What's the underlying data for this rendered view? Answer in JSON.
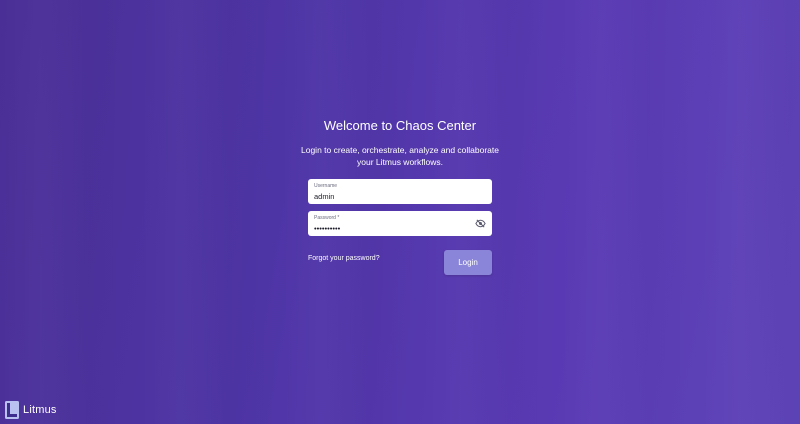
{
  "login": {
    "title": "Welcome to Chaos Center",
    "subtitle_line1": "Login to create, orchestrate, analyze and collaborate",
    "subtitle_line2": "your Litmus workflows.",
    "username": {
      "label": "Username",
      "value": "admin"
    },
    "password": {
      "label": "Password *",
      "value": "••••••••••",
      "toggle_icon": "eye-off-icon"
    },
    "forgot_label": "Forgot your password?",
    "login_label": "Login"
  },
  "brand": {
    "name": "Litmus",
    "logo_icon": "litmus-logo-icon"
  },
  "colors": {
    "background_start": "#4a2f96",
    "background_end": "#5e44b8",
    "login_button": "#8a85d8",
    "field_background": "#ffffff",
    "logo_accent": "#b9c1f0"
  }
}
